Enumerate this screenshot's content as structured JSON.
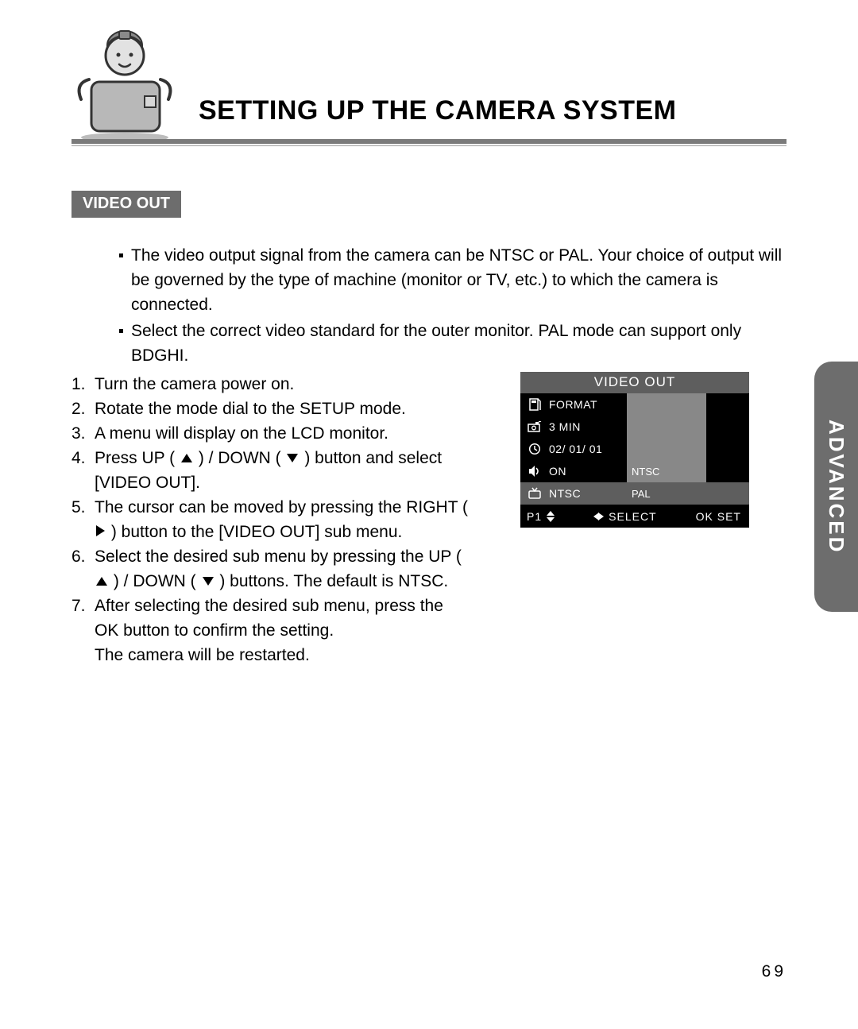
{
  "header": {
    "title": "SETTING UP THE CAMERA SYSTEM"
  },
  "section": {
    "heading": "VIDEO OUT"
  },
  "intro_bullets": [
    "The video output signal from the camera can be NTSC or PAL. Your choice of output will be governed by the type of machine (monitor or TV, etc.) to which the camera is connected.",
    "Select the correct video standard for the outer monitor. PAL mode can support only BDGHI."
  ],
  "steps": {
    "s1": "Turn the camera power on.",
    "s2": "Rotate the mode dial to the SETUP mode.",
    "s3": "A menu will display on the LCD monitor.",
    "s4a": "Press UP (",
    "s4b": ") / DOWN (",
    "s4c": ") button and select [VIDEO OUT].",
    "s5a": "The cursor can be moved by pressing the RIGHT (",
    "s5b": ") button to the [VIDEO OUT] sub menu.",
    "s6a": "Select the desired sub menu by pressing the UP (",
    "s6b": ") / DOWN (",
    "s6c": ") buttons. The default is NTSC.",
    "s7": "After selecting the desired sub menu, press the OK button to confirm the setting.\nThe camera will be restarted."
  },
  "lcd": {
    "title": "VIDEO OUT",
    "rows": [
      {
        "icon": "card-icon",
        "label": "FORMAT"
      },
      {
        "icon": "camera-icon",
        "label": "3 MIN"
      },
      {
        "icon": "clock-icon",
        "label": "02/ 01/ 01"
      },
      {
        "icon": "speaker-icon",
        "label": "ON",
        "sub": "NTSC",
        "subclass": ""
      },
      {
        "icon": "tv-icon",
        "label": "NTSC",
        "sub": "PAL",
        "selected": true,
        "subclass": "sel"
      }
    ],
    "footer": {
      "page": "P1",
      "select": "SELECT",
      "ok": "OK SET"
    }
  },
  "side_tab": "ADVANCED",
  "page_number": "69"
}
